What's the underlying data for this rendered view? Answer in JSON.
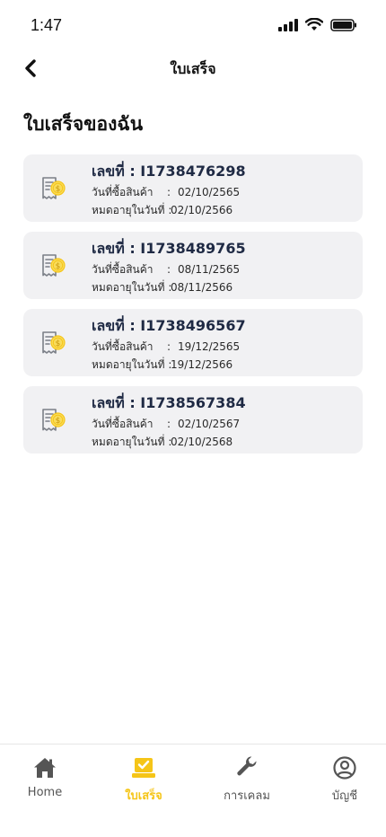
{
  "status_bar": {
    "time": "1:47"
  },
  "header": {
    "title": "ใบเสร็จ"
  },
  "section": {
    "title": "ใบเสร็จของฉัน"
  },
  "receipts": [
    {
      "number": "เลขที่ : I1738476298",
      "purchase_label": "วันที่ซื้อสินค้า",
      "purchase_date": "02/10/2565",
      "expiry_label": "หมดอายุในวันที่ :",
      "expiry_date": "02/10/2566"
    },
    {
      "number": "เลขที่ : I1738489765",
      "purchase_label": "วันที่ซื้อสินค้า",
      "purchase_date": "08/11/2565",
      "expiry_label": "หมดอายุในวันที่ :",
      "expiry_date": "08/11/2566"
    },
    {
      "number": "เลขที่ : I1738496567",
      "purchase_label": "วันที่ซื้อสินค้า",
      "purchase_date": "19/12/2565",
      "expiry_label": "หมดอายุในวันที่ :",
      "expiry_date": "19/12/2566"
    },
    {
      "number": "เลขที่ : I1738567384",
      "purchase_label": "วันที่ซื้อสินค้า",
      "purchase_date": "02/10/2567",
      "expiry_label": "หมดอายุในวันที่ :",
      "expiry_date": "02/10/2568"
    }
  ],
  "tab_bar": {
    "home": "Home",
    "receipts": "ใบเสร็จ",
    "claims": "การเคลม",
    "account": "บัญชี"
  },
  "colors": {
    "accent": "#f5c518",
    "card_bg": "#f1f1f3",
    "text_dark": "#1f2a44"
  },
  "icons": [
    "signal-icon",
    "wifi-icon",
    "battery-icon",
    "back-chevron-icon",
    "receipt-coin-icon",
    "home-icon",
    "receipt-check-icon",
    "wrench-icon",
    "user-circle-icon"
  ]
}
